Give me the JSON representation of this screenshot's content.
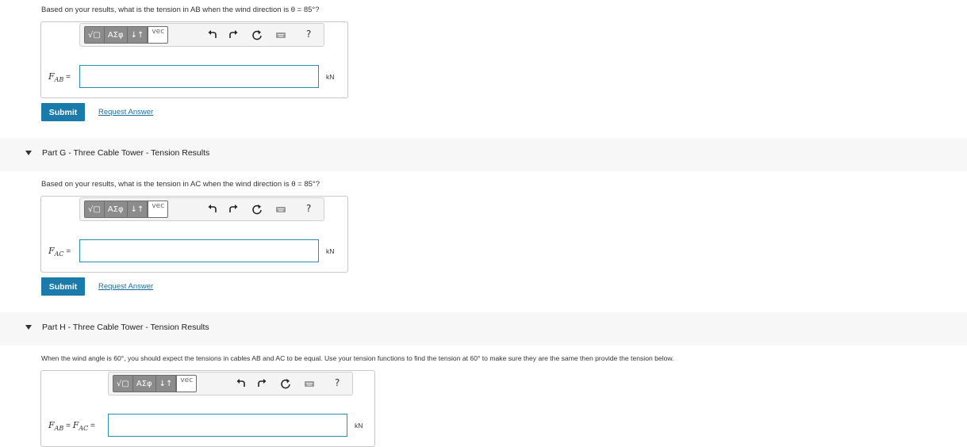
{
  "icons": [
    "template-icon",
    "undo-icon",
    "redo-icon",
    "reset-icon",
    "keyboard-icon",
    "help-icon"
  ],
  "toolbar": {
    "template_label": "√▢",
    "greek_label": "ΑΣφ",
    "arrows_label": "↓↑",
    "vec_label": "vec",
    "help_label": "?"
  },
  "part_f": {
    "question": "Based on your results, what is the tension in AB when the wind direction is θ = 85°?",
    "var_main": "F",
    "var_sub": "AB",
    "eq": " =",
    "unit": "kN",
    "value": ""
  },
  "part_g": {
    "header": "Part G - Three Cable Tower - Tension Results",
    "question": "Based on your results, what is the tension in AC when the wind direction is θ = 85°?",
    "var_main": "F",
    "var_sub": "AC",
    "eq": " =",
    "unit": "kN",
    "value": ""
  },
  "part_h": {
    "header": "Part H - Three Cable Tower - Tension Results",
    "question": "When the wind angle is 60°, you should expect the tensions in cables AB and AC to be equal. Use your tension functions to find the tension at 60° to make sure they are the same then provide the tension below.",
    "var_main1": "F",
    "var_sub1": "AB",
    "eq_mid": " = ",
    "var_main2": "F",
    "var_sub2": "AC",
    "eq": " =",
    "unit": "kN",
    "value": ""
  },
  "buttons": {
    "submit": "Submit",
    "request_answer": "Request Answer"
  }
}
